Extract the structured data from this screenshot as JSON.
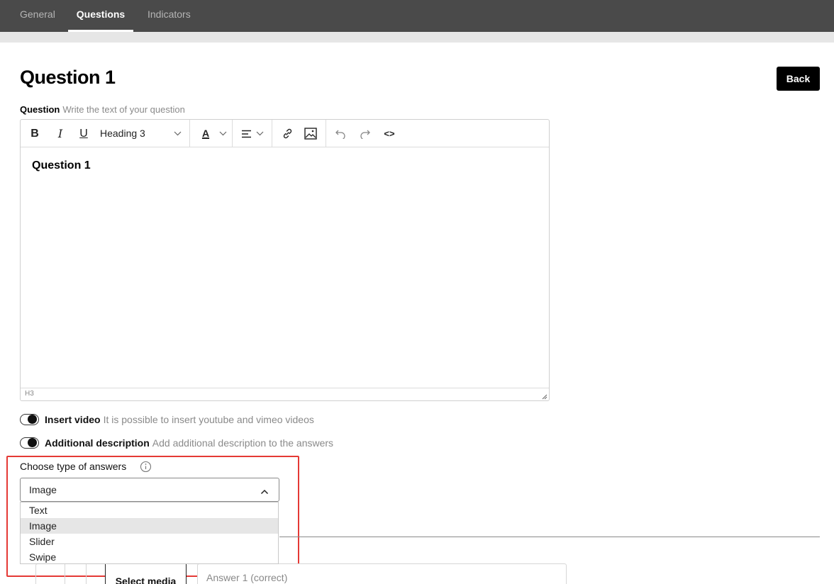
{
  "nav": {
    "tabs": [
      {
        "label": "General",
        "active": false
      },
      {
        "label": "Questions",
        "active": true
      },
      {
        "label": "Indicators",
        "active": false
      }
    ]
  },
  "page": {
    "title": "Question 1",
    "back_label": "Back"
  },
  "question": {
    "label": "Question",
    "hint": "Write the text of your question"
  },
  "editor": {
    "toolbar": {
      "bold": "B",
      "italic": "I",
      "underline": "U",
      "heading_value": "Heading 3",
      "text_color": "A",
      "source": "<>"
    },
    "content": "Question 1",
    "status_path": "H3"
  },
  "toggles": [
    {
      "label": "Insert video",
      "hint": "It is possible to insert youtube and vimeo videos"
    },
    {
      "label": "Additional description",
      "hint": "Add additional description to the answers"
    }
  ],
  "answers_type": {
    "label": "Choose type of answers",
    "selected": "Image",
    "options": [
      "Text",
      "Image",
      "Slider",
      "Swipe"
    ]
  },
  "answer_row": {
    "media_button": "Select media",
    "input_value": "Answer 1 (correct)"
  },
  "colors": {
    "nav_bg": "#4a4a4a",
    "highlight": "#e53935",
    "primary_button": "#000000"
  }
}
